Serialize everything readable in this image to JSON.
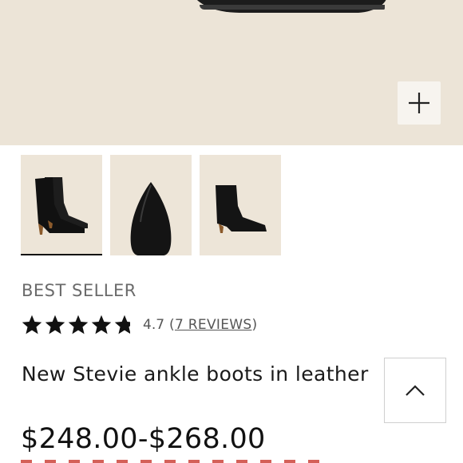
{
  "hero": {
    "zoom_icon": "plus-icon"
  },
  "thumbnails": [
    {
      "name": "boot-pair-side",
      "active": true
    },
    {
      "name": "boot-toe-top",
      "active": false
    },
    {
      "name": "boot-single-side",
      "active": false
    }
  ],
  "product": {
    "badge": "BEST SELLER",
    "rating": {
      "stars": 4.7,
      "value_label": "4.7",
      "reviews_open": "(",
      "reviews_label": "7 REVIEWS",
      "reviews_close": ")"
    },
    "title": "New Stevie ankle boots in leather",
    "price": "$248.00-$268.00"
  },
  "back_to_top": {
    "icon": "chevron-up-icon"
  },
  "colors": {
    "hero_bg": "#ece4d7",
    "star": "#111111",
    "text_muted": "#6b6b6b"
  }
}
